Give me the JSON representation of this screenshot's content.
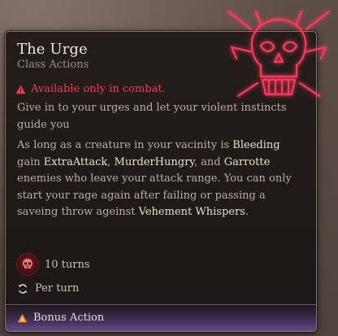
{
  "tooltip": {
    "title": "The Urge",
    "subtitle": "Class Actions",
    "warning": "Available only in combat.",
    "description": "Give in to your urges and let your violent instincts guide you",
    "effect": {
      "t1": "As long as a creature in your vacinity is ",
      "bleeding": "Bleeding",
      "t2": " gain ",
      "extra_attack": "ExtraAttack",
      "t3": ", ",
      "murder_hungry": "MurderHungry",
      "t4": ", and ",
      "garrotte": "Garrotte",
      "t5": " enemies who leave your attack range. You can only start your rage again after failing or passing a saveing throw ageinst ",
      "vehement_whispers": "Vehement Whispers",
      "t6": "."
    },
    "duration": "10 turns",
    "recharge": "Per turn",
    "cost": "Bonus Action"
  },
  "colors": {
    "warning": "#e74252",
    "highlight": "#ebe3c4",
    "body_text": "#bcae9f",
    "skull_glow": "#ff3b5c",
    "bonus_action": "#f08a2b"
  },
  "icons": {
    "warning": "warning-triangle-icon",
    "duration": "red-skull-turn-icon",
    "recharge": "refresh-cycle-icon",
    "cost": "orange-triangle-icon",
    "emblem": "glowing-skull-icon"
  }
}
